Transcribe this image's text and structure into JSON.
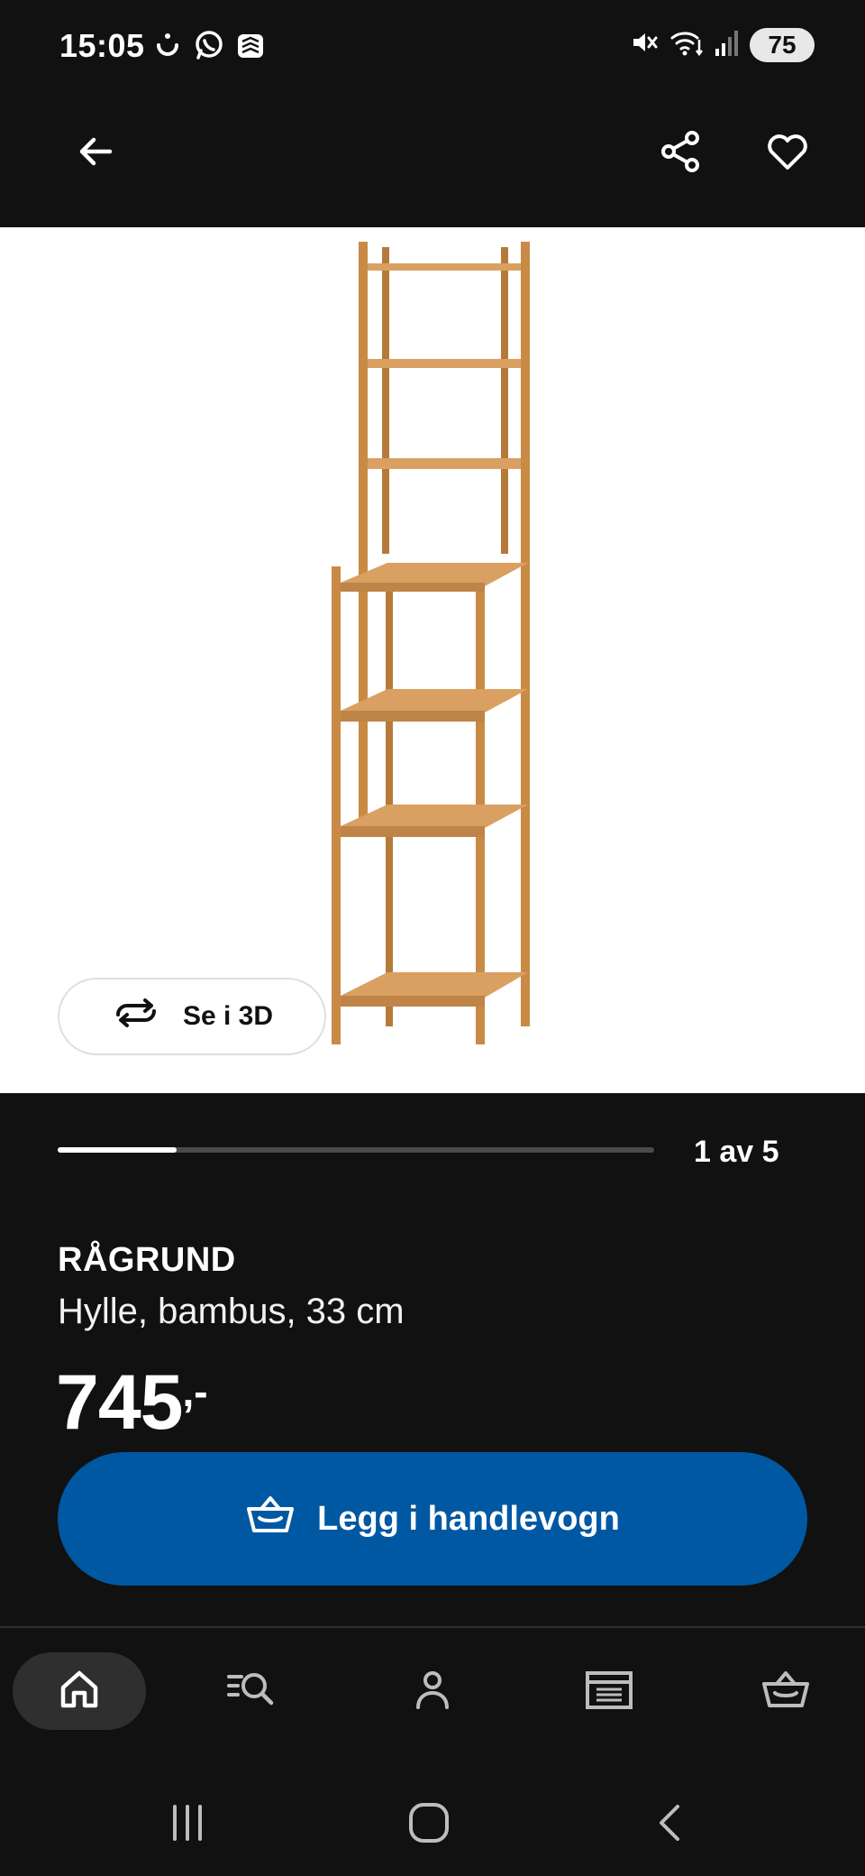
{
  "status_bar": {
    "time": "15:05",
    "left_icons": [
      "ramadan-icon",
      "whatsapp-icon",
      "stack-icon"
    ],
    "right_icons": [
      "mute-icon",
      "wifi-icon",
      "signal-icon"
    ],
    "battery": "75"
  },
  "top_nav": {
    "back_icon": "arrow-left-icon",
    "share_icon": "share-icon",
    "favorite_icon": "heart-icon"
  },
  "image": {
    "alt": "RÅGRUND",
    "view_3d_label": "Se i 3D",
    "view_3d_icon": "rotate-icon"
  },
  "gallery": {
    "counter": "1 av 5",
    "current": 1,
    "total": 5
  },
  "product": {
    "name": "RÅGRUND",
    "description": "Hylle, bambus, 33 cm",
    "price": "745",
    "price_suffix": ",-"
  },
  "add_to_cart": {
    "label": "Legg i handlevogn",
    "icon": "basket-icon",
    "color": "#0058a3"
  },
  "bottom_nav": [
    {
      "id": "home",
      "icon": "home-icon",
      "active": true
    },
    {
      "id": "search",
      "icon": "search-list-icon",
      "active": false
    },
    {
      "id": "profile",
      "icon": "person-icon",
      "active": false
    },
    {
      "id": "store",
      "icon": "store-icon",
      "active": false
    },
    {
      "id": "cart",
      "icon": "basket-icon",
      "active": false
    }
  ],
  "system_nav": [
    "recents-icon",
    "home-circle-icon",
    "back-chevron-icon"
  ],
  "colors": {
    "background": "#111111",
    "accent_blue": "#0058a3",
    "bamboo": "#c98a45"
  }
}
